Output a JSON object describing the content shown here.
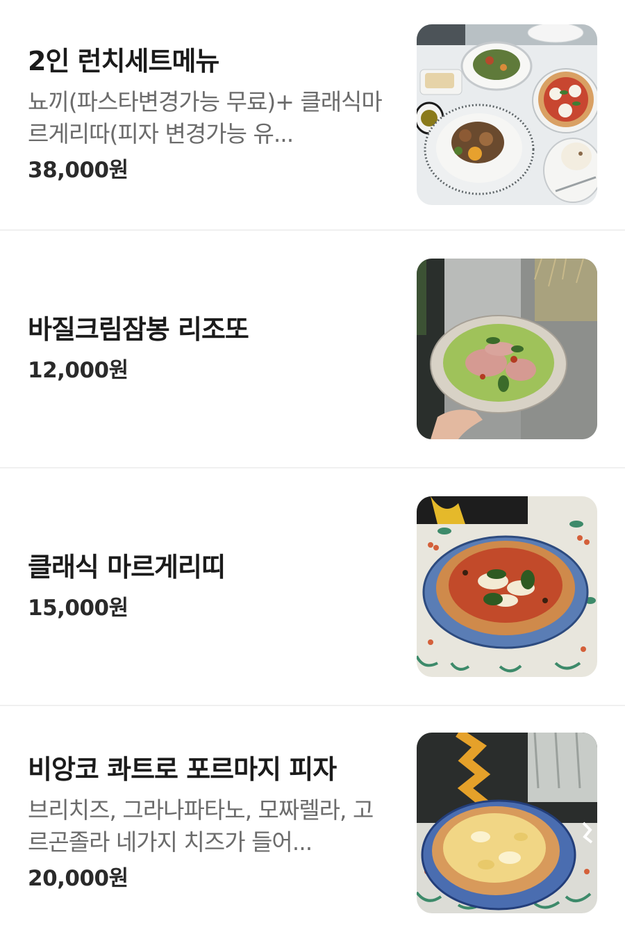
{
  "menu": {
    "items": [
      {
        "name": "2인 런치세트메뉴",
        "description": "뇨끼(파스타변경가능 무료)+ 클래식마르게리따(피자 변경가능 유...",
        "price": "38,000원",
        "image_icon": "lunch-set-photo"
      },
      {
        "name": "바질크림잠봉 리조또",
        "description": "",
        "price": "12,000원",
        "image_icon": "basil-risotto-photo"
      },
      {
        "name": "클래식 마르게리띠",
        "description": "",
        "price": "15,000원",
        "image_icon": "margherita-pizza-photo"
      },
      {
        "name": "비앙코 콰트로 포르마지 피자",
        "description": "브리치즈, 그라나파타노, 모짜렐라, 고르곤졸라 네가지 치즈가 들어...",
        "price": "20,000원",
        "image_icon": "quattro-formaggi-pizza-photo"
      }
    ]
  }
}
